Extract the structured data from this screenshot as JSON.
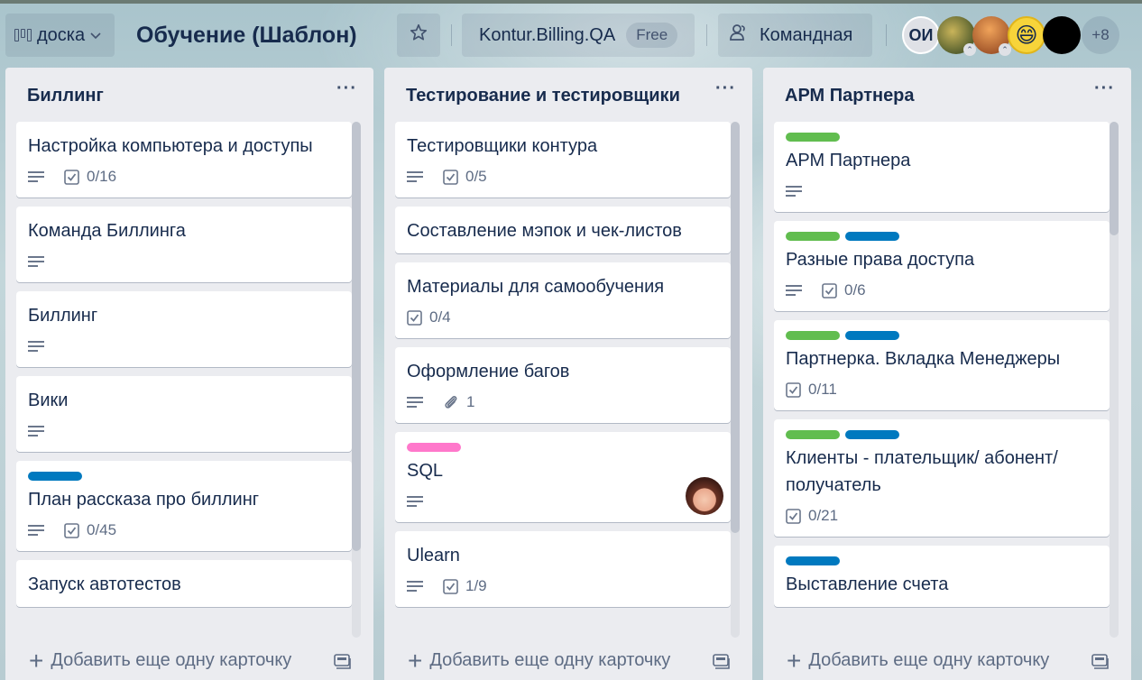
{
  "header": {
    "board_switch_label": "доска",
    "board_title": "Обучение (Шаблон)",
    "org_name": "Kontur.Billing.QA",
    "org_plan": "Free",
    "visibility_label": "Командная",
    "members": {
      "initials": "ОИ",
      "more_count": "+8"
    }
  },
  "colors": {
    "label_green": "#61bd4f",
    "label_blue": "#0079bf",
    "label_pink": "#ff78cb"
  },
  "lists": [
    {
      "title": "Биллинг",
      "menu": "···",
      "add_card_label": "Добавить еще одну карточку",
      "cards": [
        {
          "title": "Настройка компьютера и доступы",
          "checklist": "0/16"
        },
        {
          "title": "Команда Биллинга"
        },
        {
          "title": "Биллинг"
        },
        {
          "title": "Вики"
        },
        {
          "title": "План рассказа про биллинг",
          "checklist": "0/45"
        },
        {
          "title": "Запуск автотестов"
        }
      ]
    },
    {
      "title": "Тестирование и тестировщики",
      "menu": "···",
      "add_card_label": "Добавить еще одну карточку",
      "cards": [
        {
          "title": "Тестировщики контура",
          "checklist": "0/5"
        },
        {
          "title": "Составление мэпок и чек-листов"
        },
        {
          "title": "Материалы для самообучения",
          "checklist": "0/4"
        },
        {
          "title": "Оформление багов",
          "attachments": "1"
        },
        {
          "title": "SQL"
        },
        {
          "title": "Ulearn",
          "checklist": "1/9"
        }
      ]
    },
    {
      "title": "АРМ Партнера",
      "menu": "···",
      "add_card_label": "Добавить еще одну карточку",
      "cards": [
        {
          "title": "АРМ Партнера"
        },
        {
          "title": "Разные права доступа",
          "checklist": "0/6"
        },
        {
          "title": "Партнерка. Вкладка Менеджеры",
          "checklist": "0/11"
        },
        {
          "title": "Клиенты - плательщик/ абонент/ получатель",
          "checklist": "0/21"
        },
        {
          "title": "Выставление счета"
        }
      ]
    }
  ]
}
